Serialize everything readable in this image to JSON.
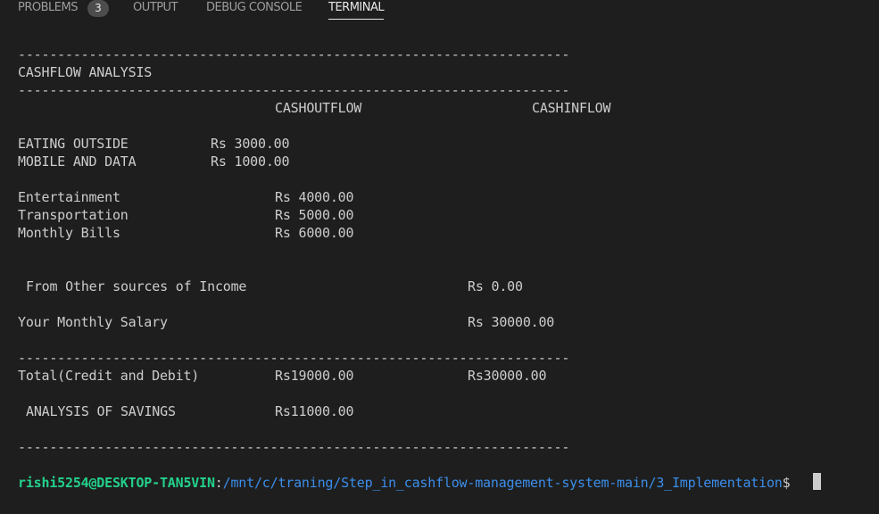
{
  "tabs": {
    "problems": "PROBLEMS",
    "problems_count": "3",
    "output": "OUTPUT",
    "debug_console": "DEBUG CONSOLE",
    "terminal": "TERMINAL"
  },
  "report": {
    "separator": "----------------------------------------------------------------------",
    "title": "CASHFLOW ANALYSIS",
    "col_outflow": "CASHOUTFLOW",
    "col_inflow": "CASHINFLOW",
    "eating_label": "EATING OUTSIDE",
    "eating_value": "Rs 3000.00",
    "mobile_label": "MOBILE AND DATA",
    "mobile_value": "Rs 1000.00",
    "entertainment_label": "Entertainment",
    "entertainment_value": "Rs 4000.00",
    "transport_label": "Transportation",
    "transport_value": "Rs 5000.00",
    "bills_label": "Monthly Bills",
    "bills_value": "Rs 6000.00",
    "other_income_label": "From Other sources of Income",
    "other_income_value": "Rs 0.00",
    "salary_label": "Your Monthly Salary",
    "salary_value": "Rs 30000.00",
    "total_label": "Total(Credit and Debit)",
    "total_debit": "Rs19000.00",
    "total_credit": "Rs30000.00",
    "savings_label": "ANALYSIS OF SAVINGS",
    "savings_value": "Rs11000.00"
  },
  "prompt": {
    "user_host": "rishi5254@DESKTOP-TAN5VIN",
    "colon": ":",
    "path": "/mnt/c/traning/Step_in_cashflow-management-system-main/3_Implementation",
    "symbol": "$"
  }
}
